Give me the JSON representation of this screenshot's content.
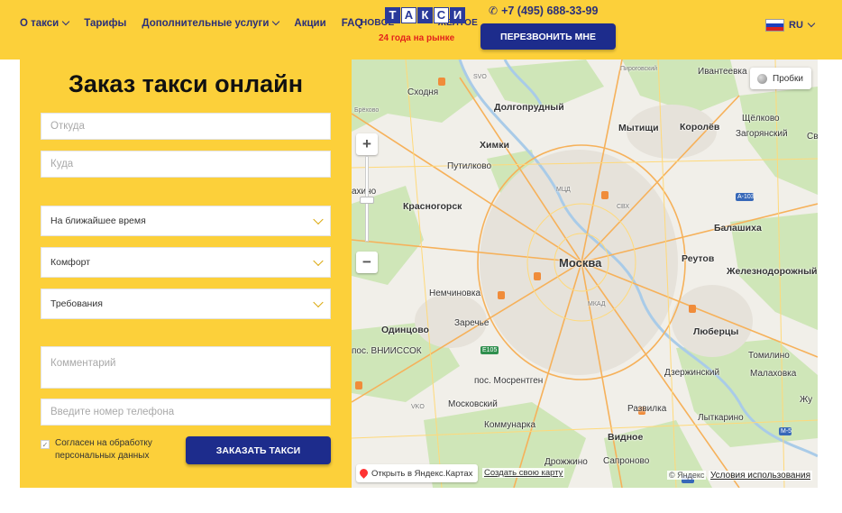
{
  "header": {
    "nav": [
      {
        "label": "О такси",
        "has_dropdown": true
      },
      {
        "label": "Тарифы",
        "has_dropdown": false
      },
      {
        "label": "Дополнительные услуги",
        "has_dropdown": true
      },
      {
        "label": "Акции",
        "has_dropdown": false
      },
      {
        "label": "FAQ",
        "has_dropdown": false
      }
    ],
    "logo": {
      "left_word": "НОВОЕ",
      "letters": [
        "Т",
        "А",
        "К",
        "С",
        "И"
      ],
      "right_word": "ЖЁЛТОЕ",
      "tagline": "24 года на рынке"
    },
    "phone": "+7 (495) 688-33-99",
    "callback_label": "ПЕРЕЗВОНИТЬ МНЕ",
    "language": "RU",
    "colors": {
      "header_bg": "#fcd03a",
      "brand_blue": "#1d2c8c",
      "brand_red": "#e3231b"
    }
  },
  "form": {
    "title": "Заказ такси онлайн",
    "from_placeholder": "Откуда",
    "to_placeholder": "Куда",
    "time_select": "На ближайшее время",
    "tariff_select": "Комфорт",
    "requirements_select": "Требования",
    "comment_placeholder": "Комментарий",
    "phone_placeholder": "Введите номер телефона",
    "consent_checked": true,
    "consent_text": "Согласен на обработку персональных данных",
    "order_label": "ЗАКАЗАТЬ ТАКСИ"
  },
  "map": {
    "traffic_label": "Пробки",
    "open_label": "Открыть в Яндекс.Картах",
    "create_label": "Создать свою карту",
    "copyright": "© Яндекс",
    "terms_label": "Условия использования",
    "places": {
      "skhodnya": "Сходня",
      "dolgoprudny": "Долгопрудный",
      "khimki": "Химки",
      "mytishchi": "Мытищи",
      "korolev": "Королёв",
      "shchelkovo": "Щёлково",
      "zagoryansky": "Загорянский",
      "pirogovsky": "Пироговский",
      "ivanteevka": "Ивантеевка",
      "putilkovo": "Путилково",
      "krasnogorsk": "Красногорск",
      "balashikha": "Балашиха",
      "moskva": "Москва",
      "reutov": "Реутов",
      "zheleznodorozhny": "Железнодорожный",
      "nemchinovka": "Немчиновка",
      "odintsovo": "Одинцово",
      "zarechye": "Заречье",
      "lyubertsy": "Люберцы",
      "vniissok": "пос. ВНИИССОК",
      "mosrentgen": "пос. Мосрентген",
      "tomilino": "Томилино",
      "dzerzhinsky": "Дзержинский",
      "malakhovka": "Малаховка",
      "moskovsky": "Московский",
      "razvilka": "Развилка",
      "zhu": "Жу",
      "kommunarka": "Коммунарка",
      "lytkarino": "Лыткарино",
      "vidnoe": "Видное",
      "drozhzhino": "Дрожжино",
      "saponovo": "Сапроново",
      "brekhovo": "Брёхово",
      "khimki_lbl": "ахино",
      "sv": "Св",
      "svo": "SVO",
      "vko": "VKO",
      "mkad": "МКАД",
      "e105": "E105",
      "a103": "A-103",
      "m5": "M-5",
      "mtsd": "МЦД",
      "svkh": "СВХ"
    }
  }
}
